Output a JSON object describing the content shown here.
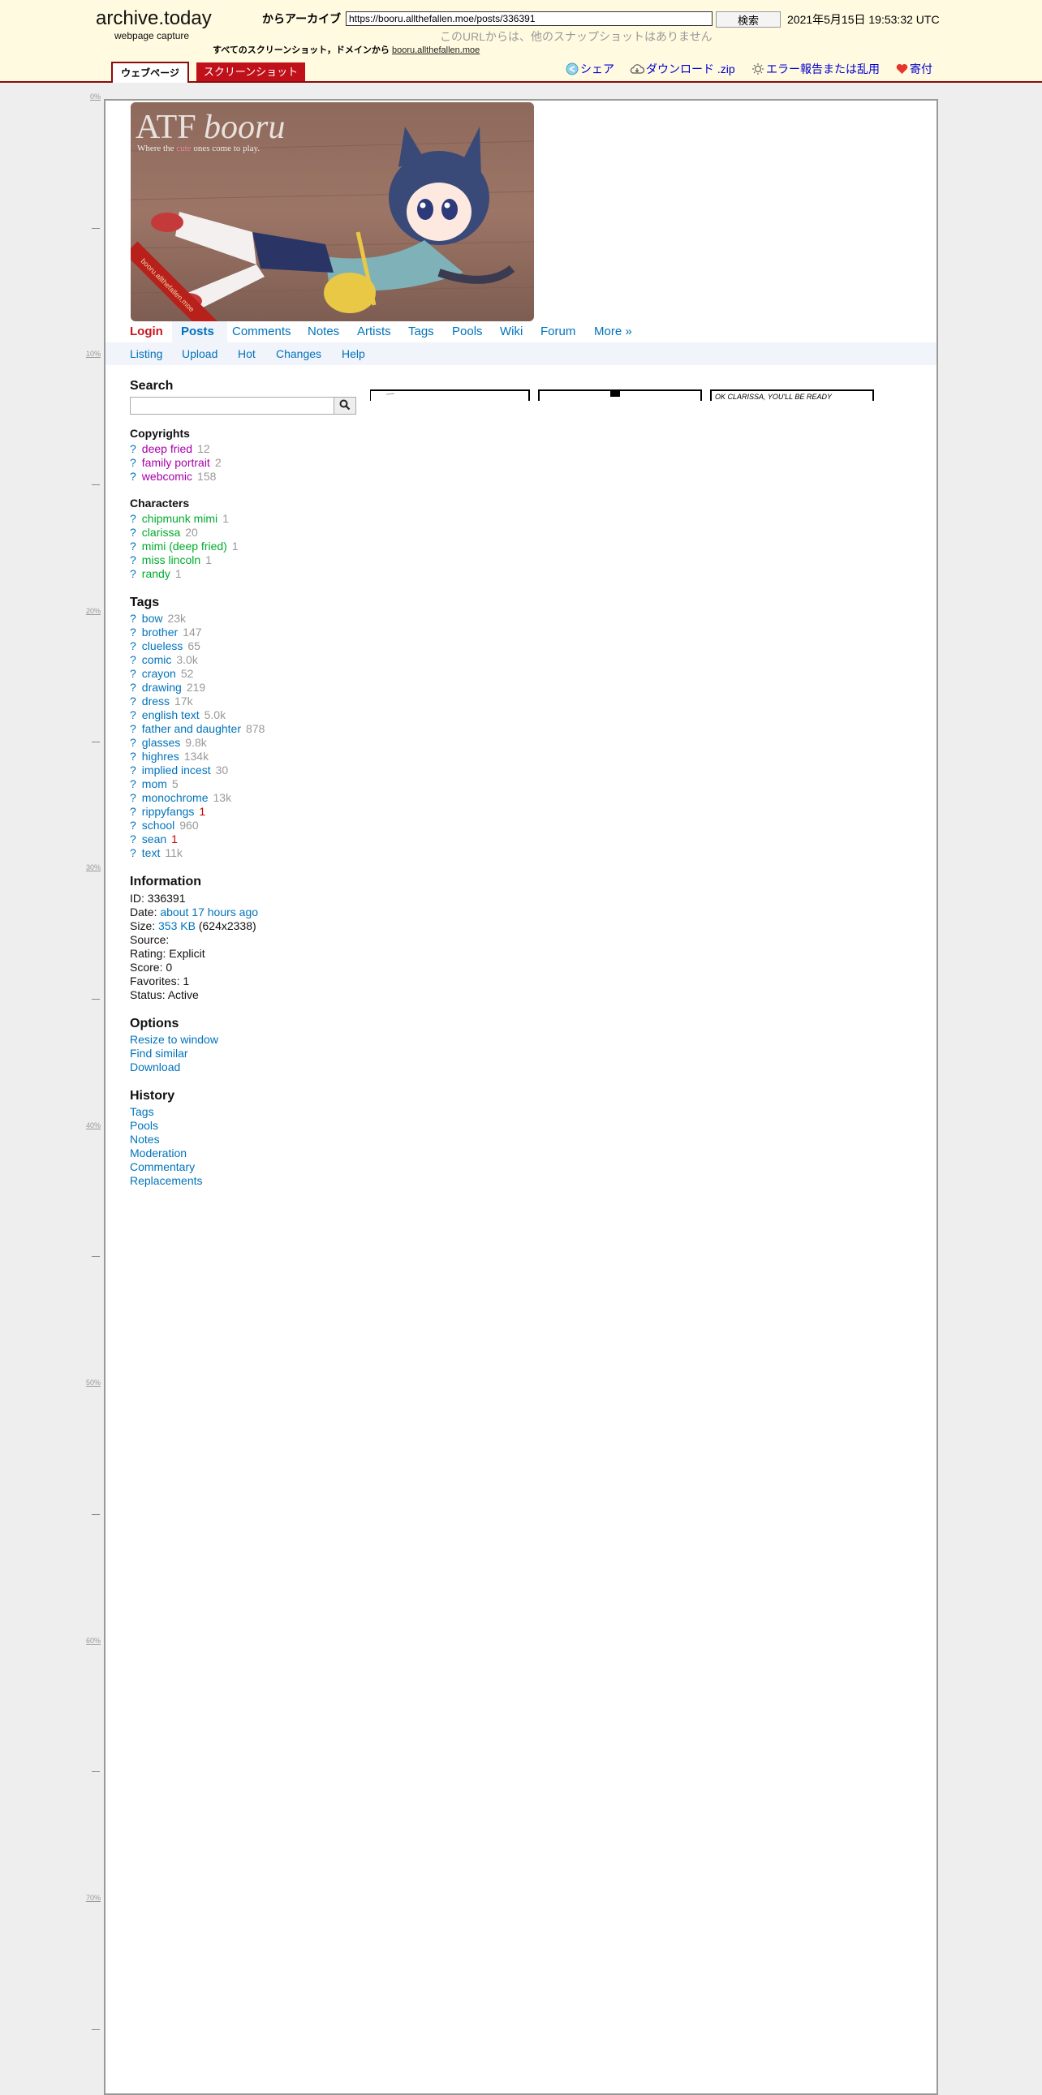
{
  "archive_header": {
    "logo": "archive.today",
    "logo_sub": "webpage capture",
    "archive_from_label": "からアーカイブ",
    "url_value": "https://booru.allthefallen.moe/posts/336391",
    "search_button": "検索",
    "timestamp": "2021年5月15日 19:53:32 UTC",
    "no_other_snapshots": "このURLからは、他のスナップショットはありません",
    "all_snapshots_prefix": "すべてのスクリーンショット，ドメインから",
    "all_snapshots_domain": "booru.allthefallen.moe",
    "tab_webpage": "ウェブページ",
    "tab_screenshot": "スクリーンショット",
    "share": "シェア",
    "download": "ダウンロード .zip",
    "report": "エラー報告または乱用",
    "donate": "寄付",
    "colors": {
      "background": "#fffae0",
      "accent": "#8b0a0a",
      "tab_red": "#c0111a",
      "link": "#0000cc"
    }
  },
  "ruler": {
    "labels": [
      "0%",
      "10%",
      "20%",
      "30%",
      "40%",
      "50%",
      "60%",
      "70%"
    ]
  },
  "site": {
    "banner": {
      "title_a": "ATF",
      "title_b": "booru",
      "tagline_pre": "Where the ",
      "tagline_cute": "cute",
      "tagline_post": " ones come to play.",
      "ribbon": "booru.allthefallen.moe",
      "icons": [
        "cat-girl-illustration",
        "shoulder-bag-icon"
      ]
    },
    "nav": {
      "login": "Login",
      "posts": "Posts",
      "comments": "Comments",
      "notes": "Notes",
      "artists": "Artists",
      "tags": "Tags",
      "pools": "Pools",
      "wiki": "Wiki",
      "forum": "Forum",
      "more": "More »"
    },
    "subnav": {
      "listing": "Listing",
      "upload": "Upload",
      "hot": "Hot",
      "changes": "Changes",
      "help": "Help"
    },
    "colors": {
      "link": "#0073bb",
      "login": "#c8171c",
      "copyright": "#a800aa",
      "character": "#00ab2c",
      "count": "#999999",
      "low_count": "#cc0000"
    }
  },
  "sidebar": {
    "search_heading": "Search",
    "search_value": "",
    "search_icon": "magnifier-icon",
    "copyrights_heading": "Copyrights",
    "copyrights": [
      {
        "name": "deep fried",
        "count": "12"
      },
      {
        "name": "family portrait",
        "count": "2"
      },
      {
        "name": "webcomic",
        "count": "158"
      }
    ],
    "characters_heading": "Characters",
    "characters": [
      {
        "name": "chipmunk mimi",
        "count": "1"
      },
      {
        "name": "clarissa",
        "count": "20"
      },
      {
        "name": "mimi (deep fried)",
        "count": "1"
      },
      {
        "name": "miss lincoln",
        "count": "1"
      },
      {
        "name": "randy",
        "count": "1"
      }
    ],
    "tags_heading": "Tags",
    "tags": [
      {
        "name": "bow",
        "count": "23k"
      },
      {
        "name": "brother",
        "count": "147"
      },
      {
        "name": "clueless",
        "count": "65"
      },
      {
        "name": "comic",
        "count": "3.0k"
      },
      {
        "name": "crayon",
        "count": "52"
      },
      {
        "name": "drawing",
        "count": "219"
      },
      {
        "name": "dress",
        "count": "17k"
      },
      {
        "name": "english text",
        "count": "5.0k"
      },
      {
        "name": "father and daughter",
        "count": "878"
      },
      {
        "name": "glasses",
        "count": "9.8k"
      },
      {
        "name": "highres",
        "count": "134k"
      },
      {
        "name": "implied incest",
        "count": "30"
      },
      {
        "name": "mom",
        "count": "5"
      },
      {
        "name": "monochrome",
        "count": "13k"
      },
      {
        "name": "rippyfangs",
        "count": "1"
      },
      {
        "name": "school",
        "count": "960"
      },
      {
        "name": "sean",
        "count": "1"
      },
      {
        "name": "text",
        "count": "11k"
      }
    ],
    "tag_question": "?",
    "information_heading": "Information",
    "info": {
      "id": "ID: 336391",
      "date_label": "Date: ",
      "date_value": "about 17 hours ago",
      "size_label": "Size: ",
      "size_value": "353 KB",
      "size_dims": " (624x2338)",
      "source": "Source:",
      "rating": "Rating: Explicit",
      "score": "Score: 0",
      "favorites": "Favorites: 1",
      "status": "Status: Active"
    },
    "options_heading": "Options",
    "options": [
      "Resize to window",
      "Find similar",
      "Download"
    ],
    "history_heading": "History",
    "history": [
      "Tags",
      "Pools",
      "Notes",
      "Moderation",
      "Commentary",
      "Replacements"
    ]
  },
  "post_image": {
    "visible_text": "OK CLARISSA, YOU'LL BE READY"
  }
}
